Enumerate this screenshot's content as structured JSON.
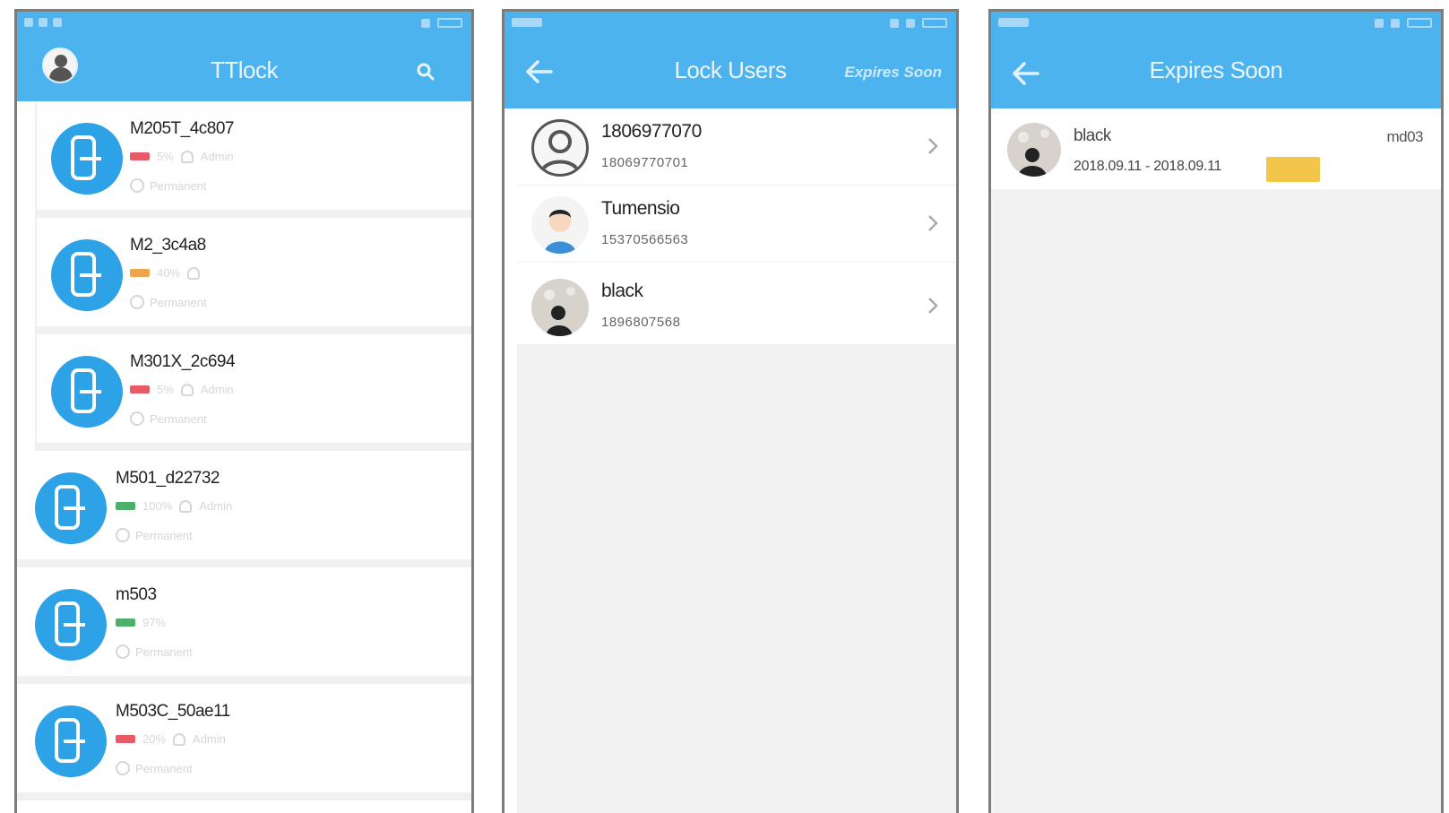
{
  "colors": {
    "primary": "#4db3ef",
    "lock_icon": "#2ea2e6",
    "expire_badge": "#f3c54a"
  },
  "screen1": {
    "title": "TTlock",
    "locks": [
      {
        "name": "M205T_4c807",
        "battery_color": "#e85b66",
        "meta": "5%",
        "role": "Admin",
        "validity": "Permanent"
      },
      {
        "name": "M2_3c4a8",
        "battery_color": "#f0a44b",
        "meta": "40%",
        "role": "",
        "validity": "Permanent"
      },
      {
        "name": "M301X_2c694",
        "battery_color": "#e85b66",
        "meta": "5%",
        "role": "Admin",
        "validity": "Permanent"
      },
      {
        "name": "M501_d22732",
        "battery_color": "#4caf6a",
        "meta": "100%",
        "role": "Admin",
        "validity": "Permanent"
      },
      {
        "name": "m503",
        "battery_color": "#4caf6a",
        "meta": "97%",
        "role": "",
        "validity": "Permanent"
      },
      {
        "name": "M503C_50ae11",
        "battery_color": "#e85b66",
        "meta": "20%",
        "role": "Admin",
        "validity": "Permanent"
      }
    ]
  },
  "screen2": {
    "title": "Lock Users",
    "action": "Expires Soon",
    "users": [
      {
        "name": "1806977070",
        "phone": "18069770701",
        "avatar": "default-avatar"
      },
      {
        "name": "Tumensio",
        "phone": "15370566563",
        "avatar": "cartoon-avatar"
      },
      {
        "name": "black",
        "phone": "1896807568",
        "avatar": "photo-avatar"
      }
    ]
  },
  "screen3": {
    "title": "Expires Soon",
    "items": [
      {
        "name": "black",
        "dates": "2018.09.11 - 2018.09.11",
        "lock": "md03"
      }
    ]
  }
}
